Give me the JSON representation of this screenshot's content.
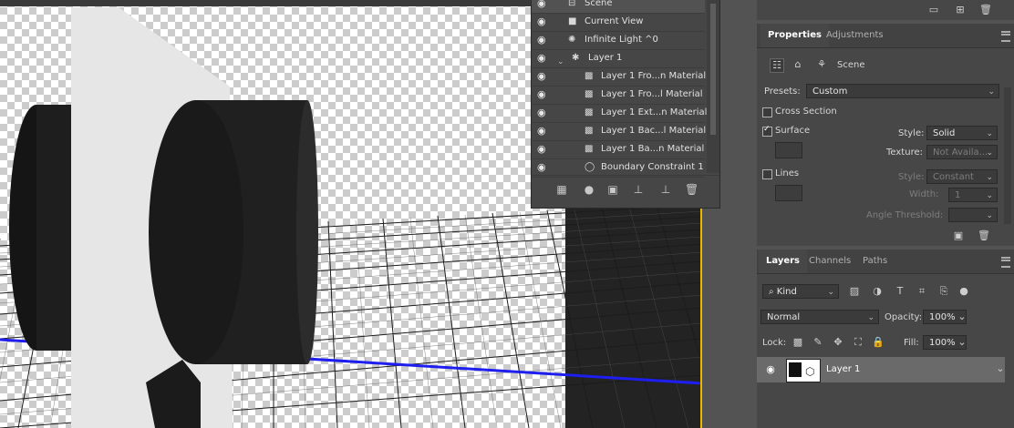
{
  "scene_panel": {
    "rows": [
      {
        "label": "Scene",
        "icon": "scene-icon"
      },
      {
        "label": "Current View",
        "icon": "camera-icon"
      },
      {
        "label": "Infinite Light ^0",
        "icon": "light-icon"
      },
      {
        "label": "Layer 1",
        "icon": "mesh-icon"
      },
      {
        "label": "Layer 1 Fro...n Material",
        "icon": "material-icon"
      },
      {
        "label": "Layer 1 Fro...l Material",
        "icon": "material-icon"
      },
      {
        "label": "Layer 1 Ext...n Material",
        "icon": "material-icon"
      },
      {
        "label": "Layer 1 Bac...l Material",
        "icon": "material-icon"
      },
      {
        "label": "Layer 1 Ba...n Material",
        "icon": "material-icon"
      },
      {
        "label": "Boundary Constraint 1",
        "icon": "constraint-icon"
      }
    ]
  },
  "properties_panel": {
    "tabs": [
      "Properties",
      "Adjustments"
    ],
    "mode_label": "Scene",
    "presets_label": "Presets:",
    "presets_value": "Custom",
    "cross_section_label": "Cross Section",
    "surface_label": "Surface",
    "style_label": "Style:",
    "surface_style_value": "Solid",
    "texture_label": "Texture:",
    "texture_value": "Not Availa...",
    "lines_label": "Lines",
    "lines_style_label": "Style:",
    "lines_style_value": "Constant",
    "width_label": "Width:",
    "width_value": "1",
    "angle_label": "Angle Threshold:"
  },
  "layers_panel": {
    "tabs": [
      "Layers",
      "Channels",
      "Paths"
    ],
    "filter_value": "Kind",
    "blend_mode": "Normal",
    "opacity_label": "Opacity:",
    "opacity_value": "100%",
    "lock_label": "Lock:",
    "fill_label": "Fill:",
    "fill_value": "100%",
    "layer_name": "Layer 1"
  },
  "colors": {
    "panel_bg": "#474747",
    "accent_gold": "#e8b800",
    "axis_blue": "#1e1ef0",
    "axis_red": "#e01010"
  }
}
